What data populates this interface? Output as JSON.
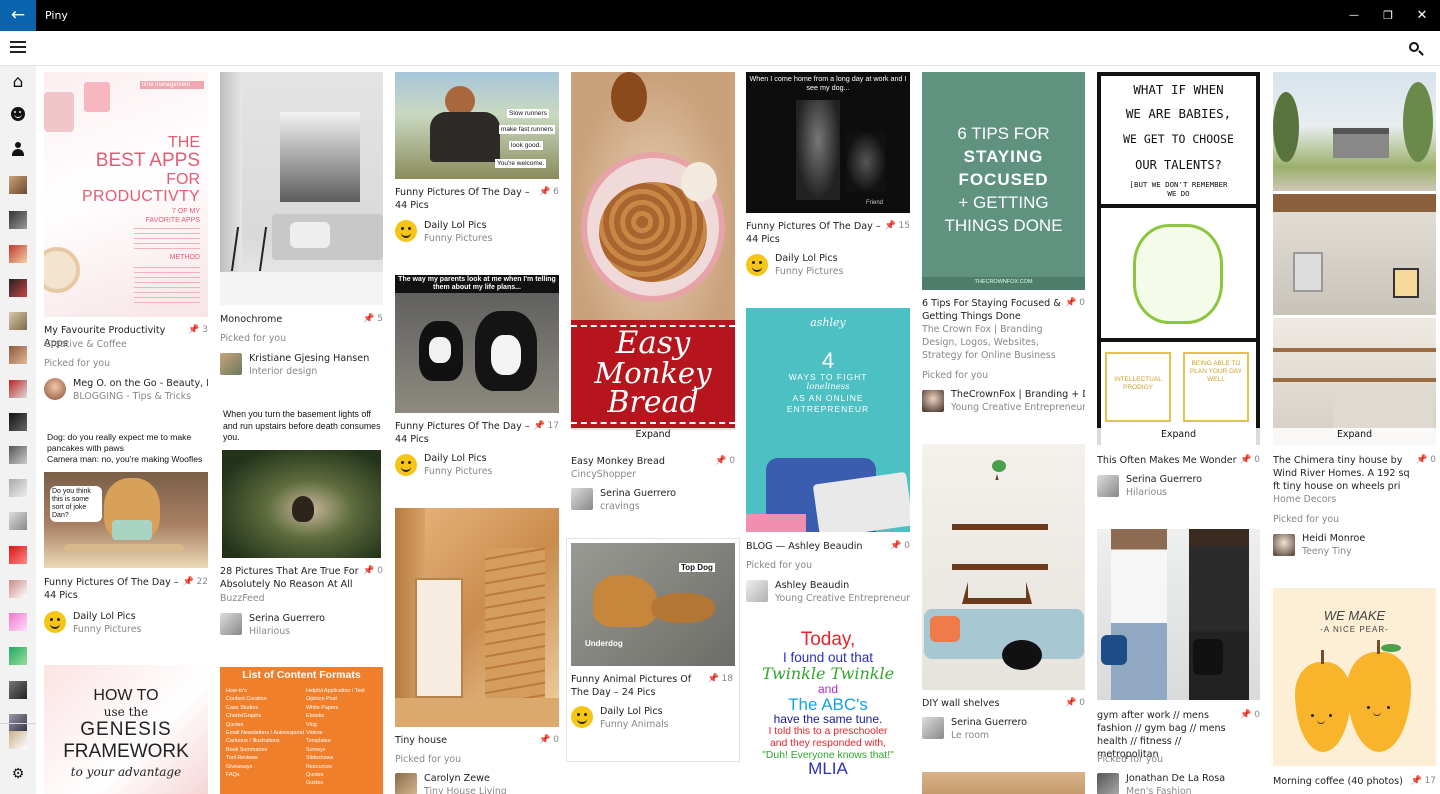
{
  "app": {
    "title": "Piny",
    "back_icon": "←",
    "minimize": "—",
    "restore": "❐",
    "close": "✕"
  },
  "sidebar": {
    "home_icon": "⌂",
    "settings_icon": "⚙"
  },
  "colors": {
    "accent": "#0a64ad",
    "titlebar": "#000000",
    "sidebar": "#f2f2f2"
  },
  "picked_label": "Picked for you",
  "expand_label": "Expand",
  "pins": {
    "c1p1": {
      "title": "My Favourite Productivity Apps",
      "count": "3",
      "sub": "Creative & Coffee",
      "user": "Meg O. on the Go - Beauty, Mc",
      "user_sub": "BLOGGING - Tips & Tricks",
      "img": {
        "tag": "time management",
        "l1": "THE",
        "l2": "BEST APPS",
        "l3": "FOR",
        "l4": "PRODUCTIVTY",
        "l5": "7 OF MY",
        "l6": "FAVORITE APPS",
        "l7": "METHOD"
      }
    },
    "c1p2": {
      "title": "Funny Pictures Of The Day – 44 Pics",
      "count": "22",
      "user": "Daily Lol Pics",
      "user_sub": "Funny Pictures",
      "img": {
        "cap": "Dog: do you really expect me to make pancakes with paws\nCamera man: no, you're making Woofles",
        "bubble": "Do you think this is some sort of joke Dan?"
      }
    },
    "c1p3": {
      "img": {
        "l1": "HOW TO",
        "l2": "use the",
        "l3": "GENESIS",
        "l4": "FRAMEWORK",
        "l5": "to your advantage"
      }
    },
    "c2p1": {
      "title": "Monochrome",
      "count": "5",
      "user": "Kristiane Gjesing Hansen",
      "user_sub": "Interior design"
    },
    "c2p2": {
      "title": "28 Pictures That Are True For Absolutely No Reason At All",
      "count": "0",
      "sub": "BuzzFeed",
      "user": "Serina Guerrero",
      "user_sub": "Hilarious",
      "img": {
        "cap": "When you turn the basement lights off and run upstairs before death consumes you."
      }
    },
    "c2p3": {
      "img": {
        "head": "List of Content Formats",
        "items": [
          "How-to's",
          "Content Curation",
          "Case Studies",
          "Charts/Graphs",
          "Quotes",
          "Email Newsletters / Autoresponders",
          "Cartoons / Illustrations",
          "Book Summaries",
          "Tool Reviews",
          "Giveaways",
          "FAQs"
        ],
        "items2": [
          "Helpful Application / Tool",
          "Opinion Post",
          "White Papers",
          "Ebooks",
          "Vlog",
          "Videos",
          "Templates",
          "Surveys",
          "Slideshows",
          "Resources",
          "Quotes",
          "Guides"
        ]
      }
    },
    "c3p1": {
      "title": "Funny Pictures Of The Day – 44 Pics",
      "count": "6",
      "user": "Daily Lol Pics",
      "user_sub": "Funny Pictures",
      "img": {
        "s1": "Slow runners",
        "s2": "make fast runners",
        "s3": "look good.",
        "s4": "You're welcome."
      }
    },
    "c3p2": {
      "title": "Funny Pictures Of The Day – 44 Pics",
      "count": "17",
      "user": "Daily Lol Pics",
      "user_sub": "Funny Pictures",
      "img": {
        "cap": "The way my parents look at me when I'm telling them about my life plans..."
      }
    },
    "c3p3": {
      "title": "Tiny house",
      "count": "0",
      "user": "Carolyn Zewe",
      "user_sub": "Tiny House Living"
    },
    "c4p1": {
      "title": "Easy Monkey Bread",
      "count": "0",
      "sub": "CincyShopper",
      "user": "Serina Guerrero",
      "user_sub": "cravings",
      "img": {
        "l1": "Easy",
        "l2": "Monkey",
        "l3": "Bread"
      }
    },
    "c4p2": {
      "title": "Funny Animal Pictures Of The Day – 24 Pics",
      "count": "18",
      "user": "Daily Lol Pics",
      "user_sub": "Funny Animals",
      "img": {
        "tag1": "Top Dog",
        "tag2": "Underdog"
      }
    },
    "c5p1": {
      "title": "Funny Pictures Of The Day – 44 Pics",
      "count": "15",
      "user": "Daily Lol Pics",
      "user_sub": "Funny Pictures",
      "img": {
        "cap": "When I come home from a long day at work and I see my dog...",
        "small": "Friend"
      }
    },
    "c5p2": {
      "title": "BLOG — Ashley Beaudin",
      "count": "0",
      "user": "Ashley Beaudin",
      "user_sub": "Young Creative Entrepreneurs",
      "img": {
        "brand": "ashley",
        "num": "4",
        "l1": "WAYS TO FIGHT",
        "l2": "loneliness",
        "l3": "AS AN ONLINE",
        "l4": "ENTREPRENEUR"
      }
    },
    "c5p3": {
      "img": {
        "l1": "Today,",
        "l2": "I found out that",
        "l3": "Twinkle Twinkle",
        "l4": "and",
        "l5": "The ABC's",
        "l6": "have the same tune.",
        "l7": "I told this to a preschooler",
        "l8": "and they responded with,",
        "l9": "\"Duh! Everyone knows that!\"",
        "l10": "MLIA"
      }
    },
    "c6p1": {
      "title": "6 Tips For Staying Focused & Getting Things Done",
      "count": "0",
      "sub": "The Crown Fox | Branding Design, Logos, Websites, Strategy for Online Business",
      "user": "TheCrownFox | Branding + Des",
      "user_sub": "Young Creative Entrepreneurs",
      "img": {
        "l1": "6 TIPS FOR",
        "l2": "STAYING",
        "l3": "FOCUSED",
        "l4": "+ GETTING",
        "l5": "THINGS DONE",
        "foot": "THECROWNFOX.COM"
      }
    },
    "c6p2": {
      "title": "DIY wall shelves",
      "count": "0",
      "user": "Serina Guerrero",
      "user_sub": "Le room"
    },
    "c7p1": {
      "title": "This Often Makes Me Wonder",
      "count": "0",
      "user": "Serina Guerrero",
      "user_sub": "Hilarious",
      "img": {
        "l1": "WHAT IF WHEN",
        "l2": "WE ARE BABIES,",
        "l3": "WE GET TO CHOOSE",
        "l4": "OUR TALENTS?",
        "l5": "[BUT WE DON'T REMEMBER",
        "l6": "WE DO",
        "p1": "INTELLECTUAL PRODIGY",
        "p2": "BEING ABLE TO PLAN YOUR DAY WELL"
      }
    },
    "c7p2": {
      "title": "gym after work // mens fashion // gym bag // mens health // fitness // metropolitan",
      "count": "0",
      "user": "Jonathan De La Rosa",
      "user_sub": "Men's Fashion"
    },
    "c8p1": {
      "title": "The Chimera tiny house by Wind River Homes. A 192 sq ft tiny house on wheels pri",
      "count": "0",
      "sub": "Home Decors",
      "user": "Heidi Monroe",
      "user_sub": "Teeny Tiny"
    },
    "c8p2": {
      "title": "Morning coffee (40 photos)",
      "count": "17",
      "img": {
        "l1": "WE MAKE",
        "l2": "-A NICE PEAR-"
      }
    }
  }
}
